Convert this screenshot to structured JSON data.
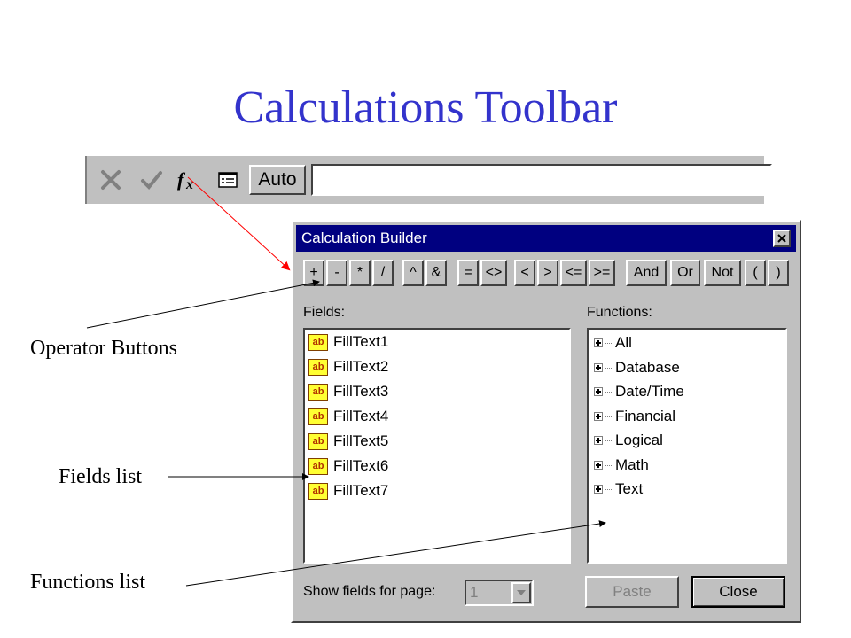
{
  "slide": {
    "title": "Calculations Toolbar"
  },
  "toolbar": {
    "icons": [
      "cancel-x-icon",
      "check-icon",
      "fx-function-icon",
      "list-icon"
    ],
    "auto_label": "Auto",
    "input_value": ""
  },
  "dialog": {
    "title": "Calculation Builder",
    "operators": [
      "+",
      "-",
      "*",
      "/",
      "^",
      "&",
      "=",
      "<>",
      "<",
      ">",
      "<=",
      ">=",
      "And",
      "Or",
      "Not",
      "(",
      ")"
    ],
    "fields_label": "Fields:",
    "functions_label": "Functions:",
    "fields": [
      "FillText1",
      "FillText2",
      "FillText3",
      "FillText4",
      "FillText5",
      "FillText6",
      "FillText7"
    ],
    "field_icon_text": "ab",
    "functions": [
      "All",
      "Database",
      "Date/Time",
      "Financial",
      "Logical",
      "Math",
      "Text"
    ],
    "show_fields_label": "Show fields for page:",
    "page_value": "1",
    "paste_label": "Paste",
    "close_label": "Close"
  },
  "callouts": {
    "operator_buttons": "Operator Buttons",
    "fields_list": "Fields list",
    "functions_list": "Functions list"
  },
  "colors": {
    "title": "#3333cc",
    "titlebar": "#000080",
    "pointer_arrow": "#ff0000"
  }
}
